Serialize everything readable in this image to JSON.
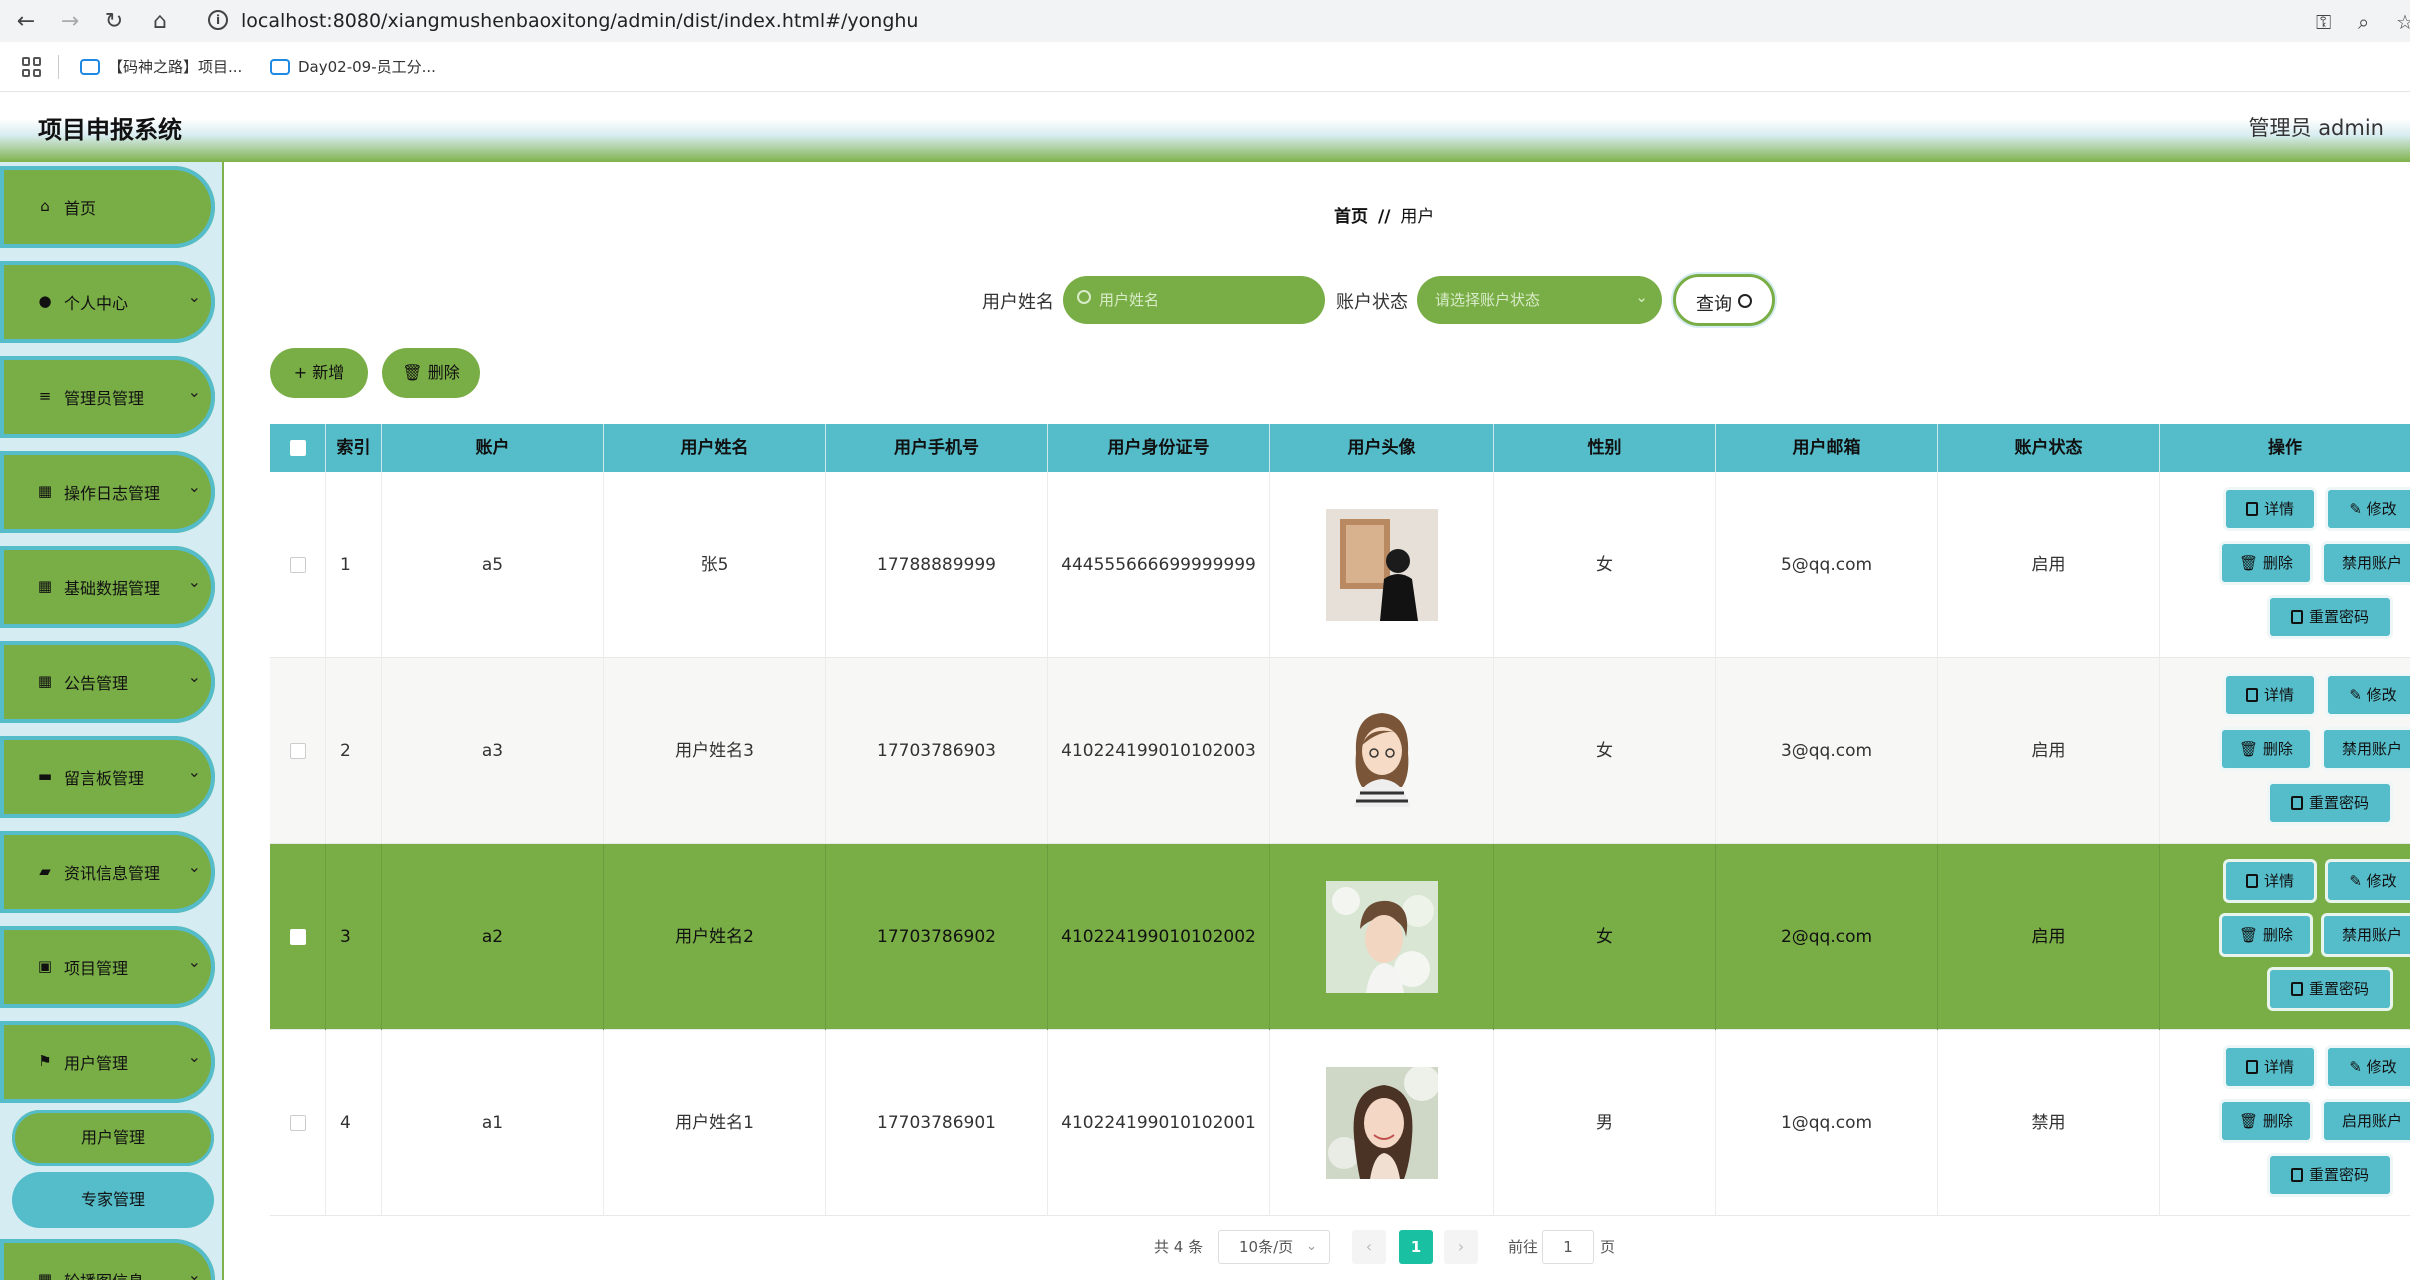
{
  "browser": {
    "url": "localhost:8080/xiangmushenbaoxitong/admin/dist/index.html#/yonghu",
    "bookmarks": [
      "【码神之路】项目...",
      "Day02-09-员工分..."
    ]
  },
  "header": {
    "title": "项目申报系统",
    "user": "管理员 admin"
  },
  "sidebar": {
    "items": [
      {
        "label": "首页",
        "icon": "home-icon"
      },
      {
        "label": "个人中心",
        "icon": "user-icon"
      },
      {
        "label": "管理员管理",
        "icon": "list-icon"
      },
      {
        "label": "操作日志管理",
        "icon": "grid-icon"
      },
      {
        "label": "基础数据管理",
        "icon": "grid-icon"
      },
      {
        "label": "公告管理",
        "icon": "grid-icon"
      },
      {
        "label": "留言板管理",
        "icon": "ticket-icon"
      },
      {
        "label": "资讯信息管理",
        "icon": "wallet-icon"
      },
      {
        "label": "项目管理",
        "icon": "calendar-icon"
      },
      {
        "label": "用户管理",
        "icon": "flag-icon"
      },
      {
        "label": "轮播图信息",
        "icon": "grid-icon"
      }
    ],
    "submenu": [
      "用户管理",
      "专家管理"
    ]
  },
  "main": {
    "breadcrumb": {
      "home": "首页",
      "sep": "//",
      "current": "用户"
    },
    "search": {
      "name_label": "用户姓名",
      "name_placeholder": "用户姓名",
      "status_label": "账户状态",
      "status_placeholder": "请选择账户状态",
      "query_label": "查询"
    },
    "actions": {
      "add": "+ 新增",
      "delete": "删除"
    },
    "table": {
      "headers": [
        "索引",
        "账户",
        "用户姓名",
        "用户手机号",
        "用户身份证号",
        "用户头像",
        "性别",
        "用户邮箱",
        "账户状态",
        "操作"
      ],
      "rows": [
        {
          "index": "1",
          "account": "a5",
          "name": "张5",
          "phone": "17788889999",
          "idcard": "444555666699999999",
          "gender": "女",
          "email": "5@qq.com",
          "status": "启用",
          "toggle": "禁用账户"
        },
        {
          "index": "2",
          "account": "a3",
          "name": "用户姓名3",
          "phone": "17703786903",
          "idcard": "410224199010102003",
          "gender": "女",
          "email": "3@qq.com",
          "status": "启用",
          "toggle": "禁用账户"
        },
        {
          "index": "3",
          "account": "a2",
          "name": "用户姓名2",
          "phone": "17703786902",
          "idcard": "410224199010102002",
          "gender": "女",
          "email": "2@qq.com",
          "status": "启用",
          "toggle": "禁用账户"
        },
        {
          "index": "4",
          "account": "a1",
          "name": "用户姓名1",
          "phone": "17703786901",
          "idcard": "410224199010102001",
          "gender": "男",
          "email": "1@qq.com",
          "status": "禁用",
          "toggle": "启用账户"
        }
      ],
      "ops": {
        "detail": "详情",
        "edit": "修改",
        "delete": "删除",
        "reset": "重置密码"
      }
    },
    "pagination": {
      "total": "共 4 条",
      "page_size": "10条/页",
      "current": "1",
      "goto_label": "前往",
      "goto_value": "1",
      "page_suffix": "页"
    }
  },
  "colors": {
    "accent_green": "#79ad46",
    "accent_cyan": "#55bcc9",
    "page_active": "#19c0a1"
  }
}
